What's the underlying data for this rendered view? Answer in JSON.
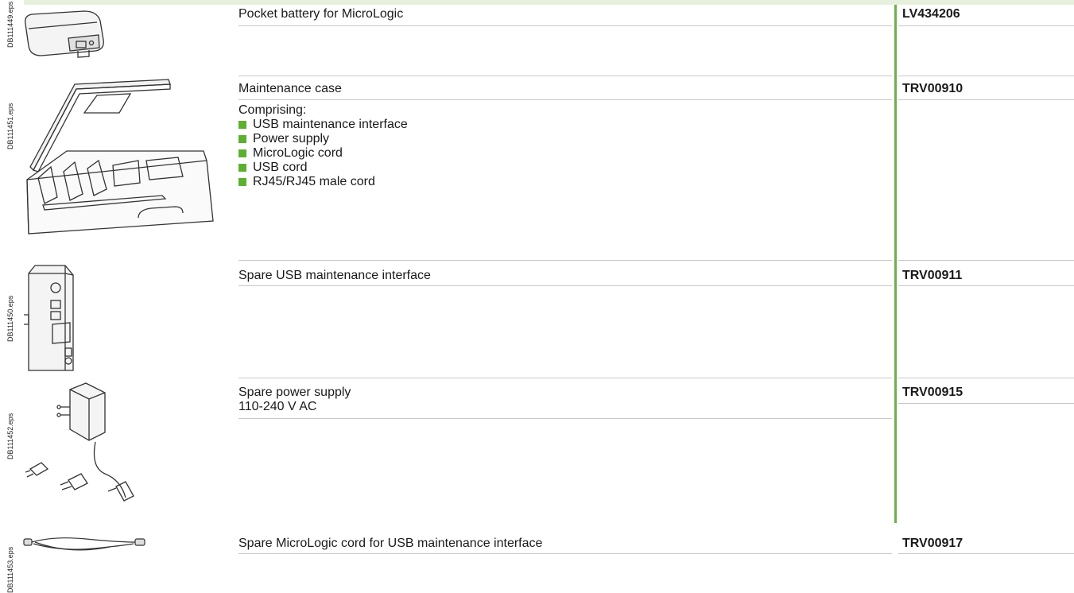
{
  "colors": {
    "accent": "#6ab04c",
    "bullet": "#5cb030",
    "top_band": "#e6f0dc",
    "rule": "#c8c8c8"
  },
  "products": [
    {
      "figure_id": "DB111449.eps",
      "description": "Pocket battery for MicroLogic",
      "reference": "LV434206"
    },
    {
      "figure_id": "DB111451.eps",
      "description": "Maintenance case",
      "reference": "TRV00910",
      "details_intro": "Comprising:",
      "details": [
        "USB maintenance interface",
        "Power supply",
        "MicroLogic cord",
        "USB cord",
        "RJ45/RJ45 male cord"
      ]
    },
    {
      "figure_id": "DB111450.eps",
      "description": "Spare USB maintenance interface",
      "reference": "TRV00911"
    },
    {
      "figure_id": "DB111452.eps",
      "description": "Spare power supply",
      "subtitle": "110-240 V AC",
      "reference": "TRV00915"
    },
    {
      "figure_id": "DB111453.eps",
      "description": "Spare MicroLogic cord for USB maintenance interface",
      "reference": "TRV00917"
    }
  ]
}
